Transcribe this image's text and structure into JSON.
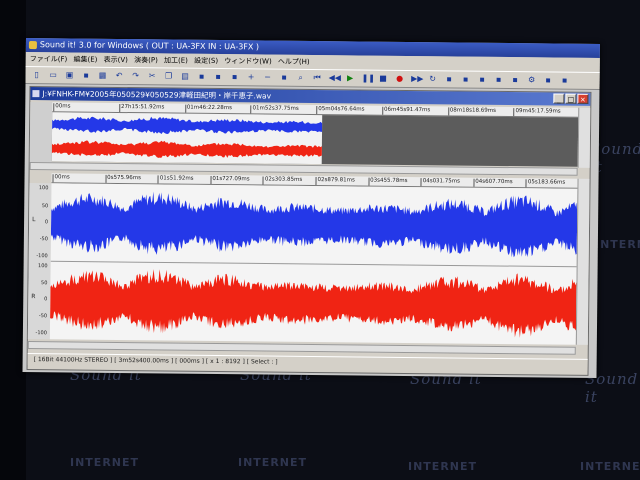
{
  "app": {
    "title": "Sound it! 3.0 for Windows  ( OUT : UA-3FX  IN : UA-3FX )",
    "menu": [
      "ファイル(F)",
      "編集(E)",
      "表示(V)",
      "演奏(P)",
      "加工(E)",
      "設定(S)",
      "ウィンドウ(W)",
      "ヘルプ(H)"
    ],
    "toolbar_icons": [
      "new-file-icon",
      "open-folder-icon",
      "save-icon",
      "save-all-icon",
      "print-icon",
      "undo-icon",
      "redo-icon",
      "cut-icon",
      "copy-icon",
      "paste-icon",
      "delete-icon",
      "trim-icon",
      "mix-icon",
      "zoom-in-icon",
      "zoom-out-icon",
      "zoom-fit-icon",
      "search-icon",
      "rewind-start-icon",
      "rewind-icon",
      "play-icon",
      "pause-icon",
      "stop-icon",
      "record-icon",
      "fast-forward-icon",
      "loop-icon",
      "marker-icon",
      "wave-icon",
      "scrub-icon",
      "fx-icon",
      "eq-icon",
      "settings-icon",
      "tool-icon",
      "meter-icon"
    ]
  },
  "document": {
    "title": "J:¥FNHK-FM¥2005年050529¥050529津軽田紀明・岸千恵子.wav",
    "overview_ruler": [
      "00ms",
      "27h15:51.92ms",
      "01m46:22.28ms",
      "01m52s37.75ms",
      "05m04s76.64ms",
      "06m45s91.47ms",
      "08m18s18.69ms",
      "09m45:17.59ms"
    ],
    "main_ruler": [
      "00ms",
      "0s575.96ms",
      "01s51.92ms",
      "01s727.09ms",
      "02s303.85ms",
      "02s879.81ms",
      "03s455.78ms",
      "04s031.75ms",
      "04s607.70ms",
      "05s183.66ms"
    ],
    "y_labels_top": [
      "100",
      "50",
      "0",
      "-50",
      "-100"
    ],
    "y_labels_bottom": [
      "100",
      "50",
      "0",
      "-50",
      "-100"
    ],
    "channel_left": "L",
    "channel_right": "R",
    "status": "[ 16Bit  44100Hz  STEREO ]  [ 3m52s400.00ms ]  [ 000ms ]  [ x 1 : 8192 ]  [ Select : ]"
  },
  "desktop": {
    "watermark_script": "Sound it",
    "watermark_net": "INTERNET"
  },
  "colors": {
    "left_channel": "#2438e8",
    "right_channel": "#f02414",
    "title_bar": "#27409a",
    "doc_title": "#1e3c9c"
  }
}
